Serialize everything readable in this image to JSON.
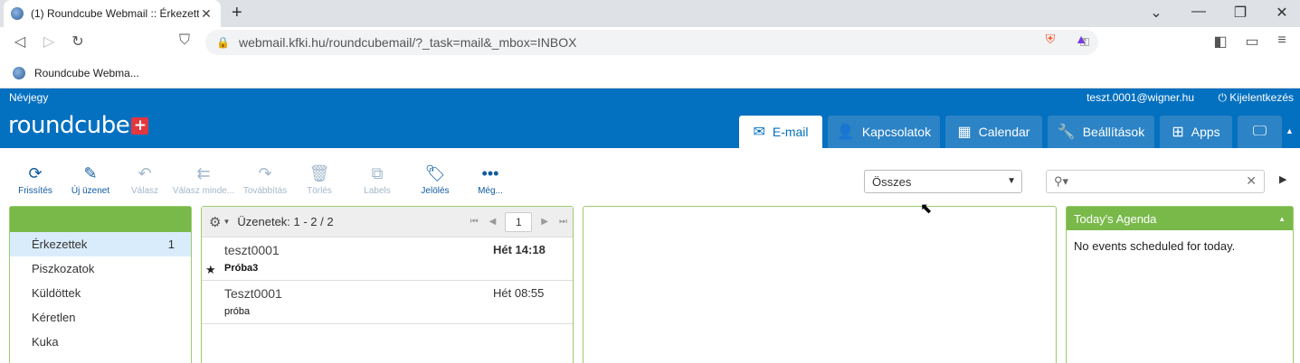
{
  "browser": {
    "tab_title": "(1) Roundcube Webmail :: Érkezett",
    "tab_close": "✕",
    "new_tab": "+",
    "window_controls": [
      "⌄",
      "—",
      "❐",
      "✕"
    ],
    "url": "webmail.kfki.hu/roundcubemail/?_task=mail&_mbox=INBOX",
    "bookmark_label": "Roundcube Webma..."
  },
  "header": {
    "about": "Névjegy",
    "user": "teszt.0001@wigner.hu",
    "logout": "Kijelentkezés",
    "logo": "roundcube",
    "logo_plus": "+"
  },
  "tasks": [
    {
      "label": "E-mail",
      "icon": "✉"
    },
    {
      "label": "Kapcsolatok",
      "icon": "👤"
    },
    {
      "label": "Calendar",
      "icon": "▦"
    },
    {
      "label": "Beállítások",
      "icon": "🔧"
    },
    {
      "label": "Apps",
      "icon": "⊞"
    },
    {
      "label": "",
      "icon": "🖵"
    }
  ],
  "toolbar": {
    "refresh": "Frissítés",
    "compose": "Új üzenet",
    "reply": "Válasz",
    "reply_all": "Válasz minde...",
    "forward": "Továbbítás",
    "delete": "Törlés",
    "labels": "Labels",
    "mark": "Jelölés",
    "more": "Még..."
  },
  "filter": {
    "value": "Összes"
  },
  "folders": [
    {
      "name": "Érkezettek",
      "unread": "1"
    },
    {
      "name": "Piszkozatok",
      "unread": ""
    },
    {
      "name": "Küldöttek",
      "unread": ""
    },
    {
      "name": "Kéretlen",
      "unread": ""
    },
    {
      "name": "Kuka",
      "unread": ""
    }
  ],
  "messagelist": {
    "count": "Üzenetek: 1 - 2 / 2",
    "page": "1",
    "messages": [
      {
        "from": "teszt0001",
        "date": "Hét 14:18",
        "subject": "Próba3",
        "unread": true,
        "flagged": true
      },
      {
        "from": "Teszt0001",
        "date": "Hét 08:55",
        "subject": "próba",
        "unread": false,
        "flagged": false
      }
    ]
  },
  "agenda": {
    "title": "Today's Agenda",
    "empty": "No events scheduled for today."
  },
  "colors": {
    "header_blue": "#0470c0",
    "panel_green": "#79b94a"
  }
}
